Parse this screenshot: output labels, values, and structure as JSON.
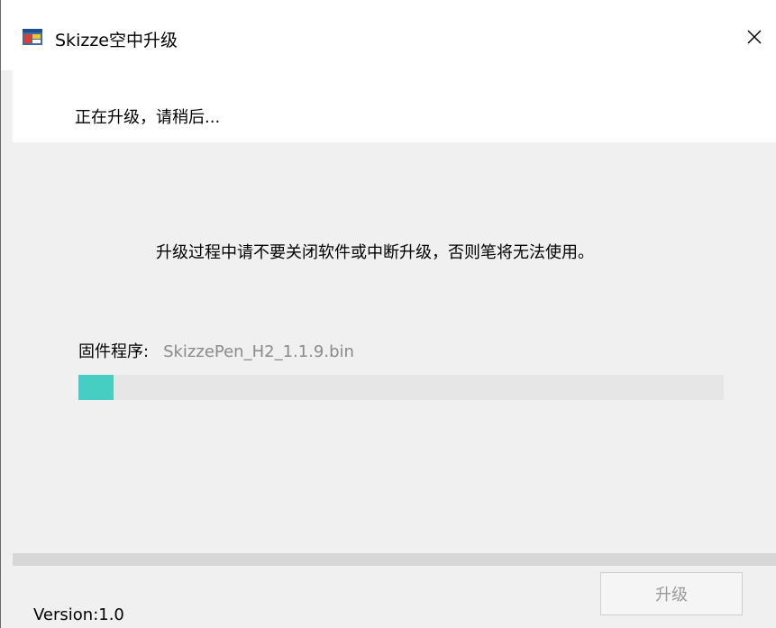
{
  "window": {
    "title": "Skizze空中升级",
    "close_glyph": "✕",
    "icon": "app-window-icon"
  },
  "header": {
    "status_text": "正在升级，请稍后..."
  },
  "main": {
    "warning": "升级过程中请不要关闭软件或中断升级，否则笔将无法使用。",
    "firmware_label": "固件程序:",
    "firmware_file": "SkizzePen_H2_1.1.9.bin",
    "progress_fraction": 0.055,
    "progress_color": "#47cec3"
  },
  "footer": {
    "upgrade_button_label": "升级",
    "upgrade_button_enabled": false,
    "version_text": "Version:1.0"
  }
}
